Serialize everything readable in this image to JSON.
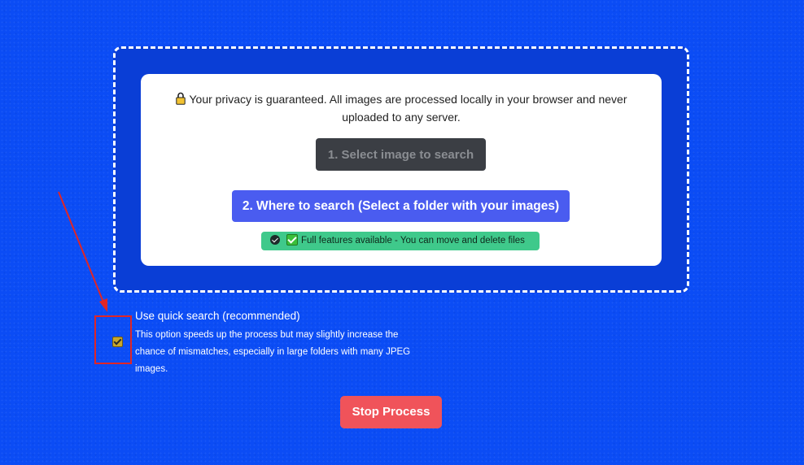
{
  "privacy_notice": {
    "icon": "lock-icon",
    "text": "Your privacy is guaranteed. All images are processed locally in your browser and never uploaded to any server."
  },
  "buttons": {
    "select_image_label": "1. Select image to search",
    "where_to_search_label": "2. Where to search (Select a folder with your images)",
    "stop_process_label": "Stop Process"
  },
  "features_badge": {
    "icons": [
      "check-circle-icon",
      "check-box-icon"
    ],
    "text": "Full features available - You can move and delete files"
  },
  "quick_search": {
    "label": "Use quick search (recommended)",
    "description": "This option speeds up the process but may slightly increase the chance of mismatches, especially in large folders with many JPEG images.",
    "checked": true
  },
  "colors": {
    "background": "#0b4cf5",
    "drop_zone": "#0a3ed6",
    "select_button": "#3b3e44",
    "where_button": "#4a5cf0",
    "badge": "#3fc98b",
    "stop_button": "#f0535a",
    "annotation": "#e02626"
  }
}
